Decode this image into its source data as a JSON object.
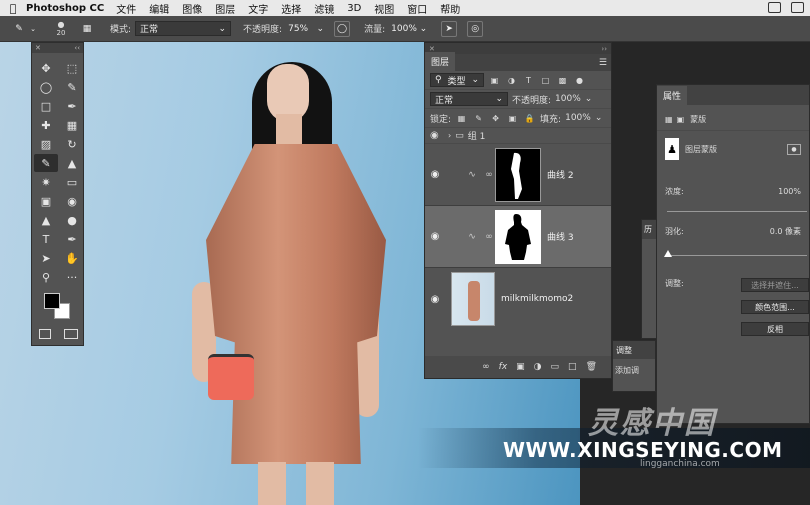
{
  "menubar": {
    "app_name": "Photoshop CC",
    "items": [
      "文件",
      "编辑",
      "图像",
      "图层",
      "文字",
      "选择",
      "滤镜",
      "3D",
      "视图",
      "窗口",
      "帮助"
    ]
  },
  "options_bar": {
    "brush_size": "20",
    "mode_label": "模式:",
    "mode_value": "正常",
    "opacity_label": "不透明度:",
    "opacity_value": "75%",
    "flow_label": "流量:",
    "flow_value": "100%"
  },
  "layers_panel": {
    "tab_label": "图层",
    "filter_kind": "类型",
    "blend_mode": "正常",
    "opacity_label": "不透明度:",
    "opacity_value": "100%",
    "lock_label": "锁定:",
    "fill_label": "填充:",
    "fill_value": "100%",
    "group_name": "组 1",
    "layers": [
      {
        "name": "曲线 2",
        "selected": false
      },
      {
        "name": "曲线 3",
        "selected": true
      },
      {
        "name": "milkmilkmomo2",
        "selected": false
      }
    ]
  },
  "properties_panel": {
    "tab_label": "属性",
    "mask_title": "蒙版",
    "layer_mask_label": "图层蒙版",
    "density_label": "浓度:",
    "density_value": "100%",
    "feather_label": "羽化:",
    "feather_value": "0.0 像素",
    "refine_label": "调整:",
    "select_mask_button": "选择并遮住...",
    "color_range_button": "颜色范围...",
    "invert_button": "反相"
  },
  "history_panel": {
    "tab_label": "历"
  },
  "adjust_panel": {
    "tab_label": "调整",
    "add_label": "添加调"
  },
  "watermark": {
    "logo_text": "灵感中国",
    "url_text": "WWW.XINGSEYING.COM",
    "small_text": "lingganchina.com"
  }
}
